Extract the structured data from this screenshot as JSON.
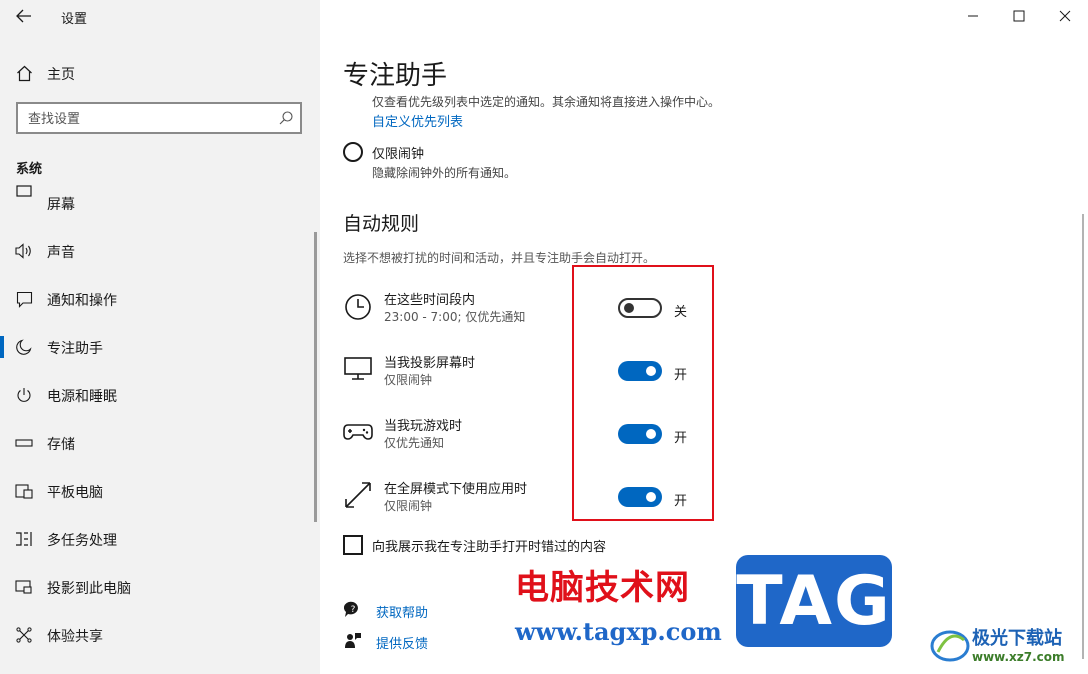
{
  "app": {
    "title": "设置"
  },
  "sidebar": {
    "home_label": "主页",
    "search_placeholder": "查找设置",
    "section_label": "系统",
    "items": [
      {
        "label": "屏幕",
        "icon": "display-icon"
      },
      {
        "label": "声音",
        "icon": "speaker-icon"
      },
      {
        "label": "通知和操作",
        "icon": "notification-icon"
      },
      {
        "label": "专注助手",
        "icon": "moon-icon",
        "active": true
      },
      {
        "label": "电源和睡眠",
        "icon": "power-icon"
      },
      {
        "label": "存储",
        "icon": "storage-icon"
      },
      {
        "label": "平板电脑",
        "icon": "tablet-icon"
      },
      {
        "label": "多任务处理",
        "icon": "multitask-icon"
      },
      {
        "label": "投影到此电脑",
        "icon": "project-icon"
      },
      {
        "label": "体验共享",
        "icon": "share-icon"
      }
    ]
  },
  "main": {
    "title": "专注助手",
    "priority_desc": "仅查看优先级列表中选定的通知。其余通知将直接进入操作中心。",
    "priority_link": "自定义优先列表",
    "alarms_only": {
      "label": "仅限闹钟",
      "desc": "隐藏除闹钟外的所有通知。"
    },
    "auto_rules": {
      "heading": "自动规则",
      "desc": "选择不想被打扰的时间和活动，并且专注助手会自动打开。",
      "rules": [
        {
          "title": "在这些时间段内",
          "sub": "23:00 - 7:00; 仅优先通知",
          "state": "关",
          "on": false,
          "icon": "clock-icon"
        },
        {
          "title": "当我投影屏幕时",
          "sub": "仅限闹钟",
          "state": "开",
          "on": true,
          "icon": "monitor-icon"
        },
        {
          "title": "当我玩游戏时",
          "sub": "仅优先通知",
          "state": "开",
          "on": true,
          "icon": "gamepad-icon"
        },
        {
          "title": "在全屏模式下使用应用时",
          "sub": "仅限闹钟",
          "state": "开",
          "on": true,
          "icon": "fullscreen-icon"
        }
      ]
    },
    "missed_checkbox_label": "向我展示我在专注助手打开时错过的内容",
    "help_links": {
      "get_help": "获取帮助",
      "feedback": "提供反馈"
    }
  },
  "watermark": {
    "site_name": "电脑技术网",
    "site_url": "www.tagxp.com",
    "tag": "TAG",
    "xz_name": "极光下载站",
    "xz_url": "www.xz7.com"
  },
  "colors": {
    "accent": "#0067c0",
    "highlight": "#e0101a",
    "sidebar_bg": "#f2f2f2"
  }
}
